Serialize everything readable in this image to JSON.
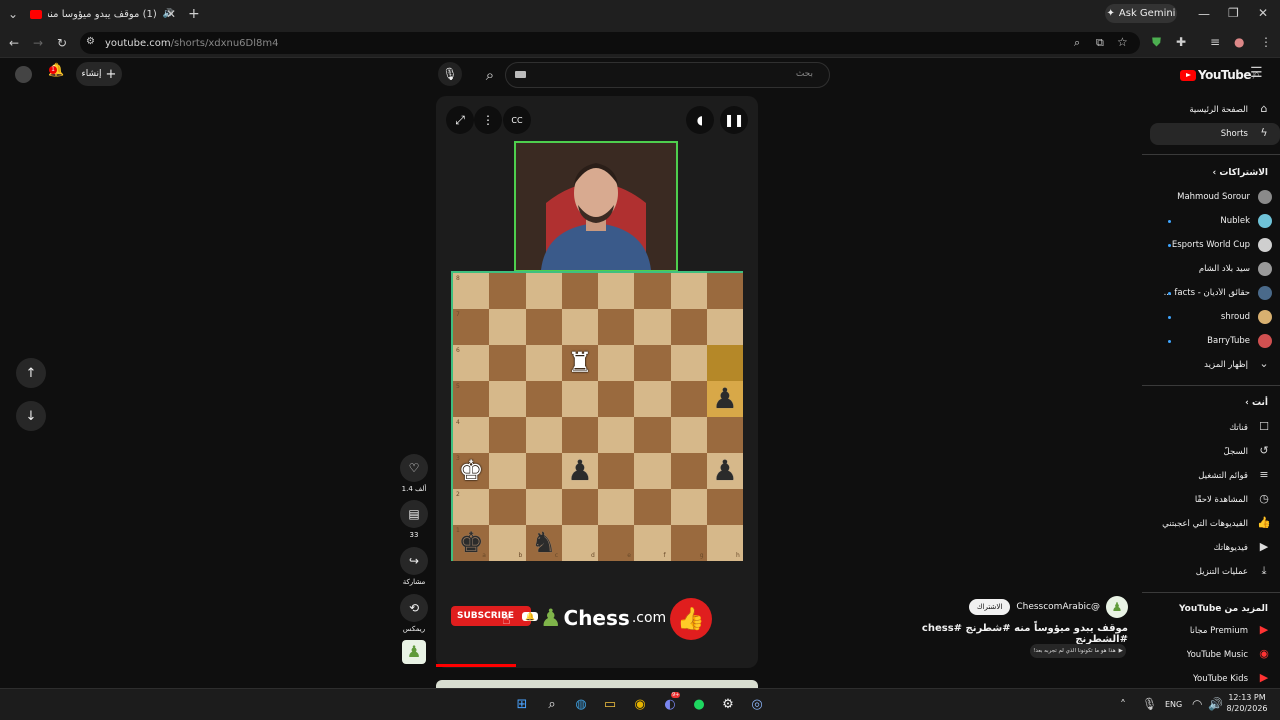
{
  "browser": {
    "tab_title": "(1) موقف يبدو ميؤوساً منه #",
    "url_host": "youtube.com",
    "url_path": "/shorts/xdxnu6Dl8m4",
    "ask_gemini": "Ask Gemini"
  },
  "header": {
    "logo_text": "YouTube",
    "logo_country": "JO",
    "search_placeholder": "بحث",
    "create_label": "إنشاء",
    "notification_count": "1"
  },
  "sidebar": {
    "main": [
      {
        "label": "الصفحة الرئيسية",
        "icon": "home-icon"
      },
      {
        "label": "Shorts",
        "icon": "shorts-icon",
        "active": true
      }
    ],
    "subscriptions_header": "الاشتراكات",
    "subscriptions": [
      {
        "label": "Mahmoud Sorour",
        "dot": false,
        "color": "#8a8a8a"
      },
      {
        "label": "Nublek",
        "dot": true,
        "color": "#6fc3d8"
      },
      {
        "label": "Esports World Cup",
        "dot": true,
        "color": "#cfcfcf"
      },
      {
        "label": "سيد بلاد الشام",
        "dot": false,
        "color": "#9a9a9a"
      },
      {
        "label": "حقائق الأديان - facts ...",
        "dot": true,
        "color": "#4a6a8a"
      },
      {
        "label": "shroud",
        "dot": true,
        "color": "#d8b070"
      },
      {
        "label": "BarryTube",
        "dot": true,
        "color": "#d05050"
      }
    ],
    "show_more": "إظهار المزيد",
    "you_header": "أنت",
    "you_items": [
      {
        "label": "قناتك",
        "icon": "channel-icon"
      },
      {
        "label": "السجلّ",
        "icon": "history-icon"
      },
      {
        "label": "قوائم التشغيل",
        "icon": "playlists-icon"
      },
      {
        "label": "المشاهدة لاحقًا",
        "icon": "watch-later-icon"
      },
      {
        "label": "الفيديوهات التي أعجبتني",
        "icon": "liked-icon"
      },
      {
        "label": "فيديوهاتك",
        "icon": "your-videos-icon"
      },
      {
        "label": "عمليات التنزيل",
        "icon": "downloads-icon"
      }
    ],
    "more_header_prefix": "المزيد من",
    "more_header_brand": "YouTube",
    "more_items": [
      {
        "label": "Premium",
        "suffix": "مجاناً"
      },
      {
        "label": "YouTube Music",
        "suffix": ""
      },
      {
        "label": "YouTube Kids",
        "suffix": ""
      }
    ]
  },
  "short": {
    "board_files": [
      "a",
      "b",
      "c",
      "d",
      "e",
      "f",
      "g",
      "h"
    ],
    "board_ranks": [
      "8",
      "7",
      "6",
      "5",
      "4",
      "3",
      "2",
      "1"
    ],
    "pieces": [
      {
        "square": "d6",
        "glyph": "♜",
        "color": "white"
      },
      {
        "square": "h5",
        "glyph": "♟",
        "color": "black"
      },
      {
        "square": "a3",
        "glyph": "♚",
        "color": "white"
      },
      {
        "square": "d3",
        "glyph": "♟",
        "color": "black"
      },
      {
        "square": "h3",
        "glyph": "♟",
        "color": "black"
      },
      {
        "square": "a1",
        "glyph": "♚",
        "color": "black"
      },
      {
        "square": "c1",
        "glyph": "♞",
        "color": "black"
      }
    ],
    "highlight_squares": [
      "h6",
      "h5"
    ],
    "subscribe_label": "SUBSCRIBE",
    "brand": "Chess",
    "brand_suffix": ".com"
  },
  "actions": {
    "likes": "1.4 ألف",
    "comments": "33",
    "share": "مشاركة",
    "remix": "ريمكس"
  },
  "video": {
    "channel": "@ChesscomArabic",
    "subscribe": "الاشتراك",
    "title": "موقف يبدو ميؤوساً منه #شطرنج #chess #الشطرنج",
    "pill": "هذا هو ما تكونونا الذي لم تجربه بعد!"
  },
  "taskbar": {
    "lang": "ENG",
    "time": "12:13 PM",
    "date": "8/20/2026",
    "discord_badge": "9+"
  }
}
